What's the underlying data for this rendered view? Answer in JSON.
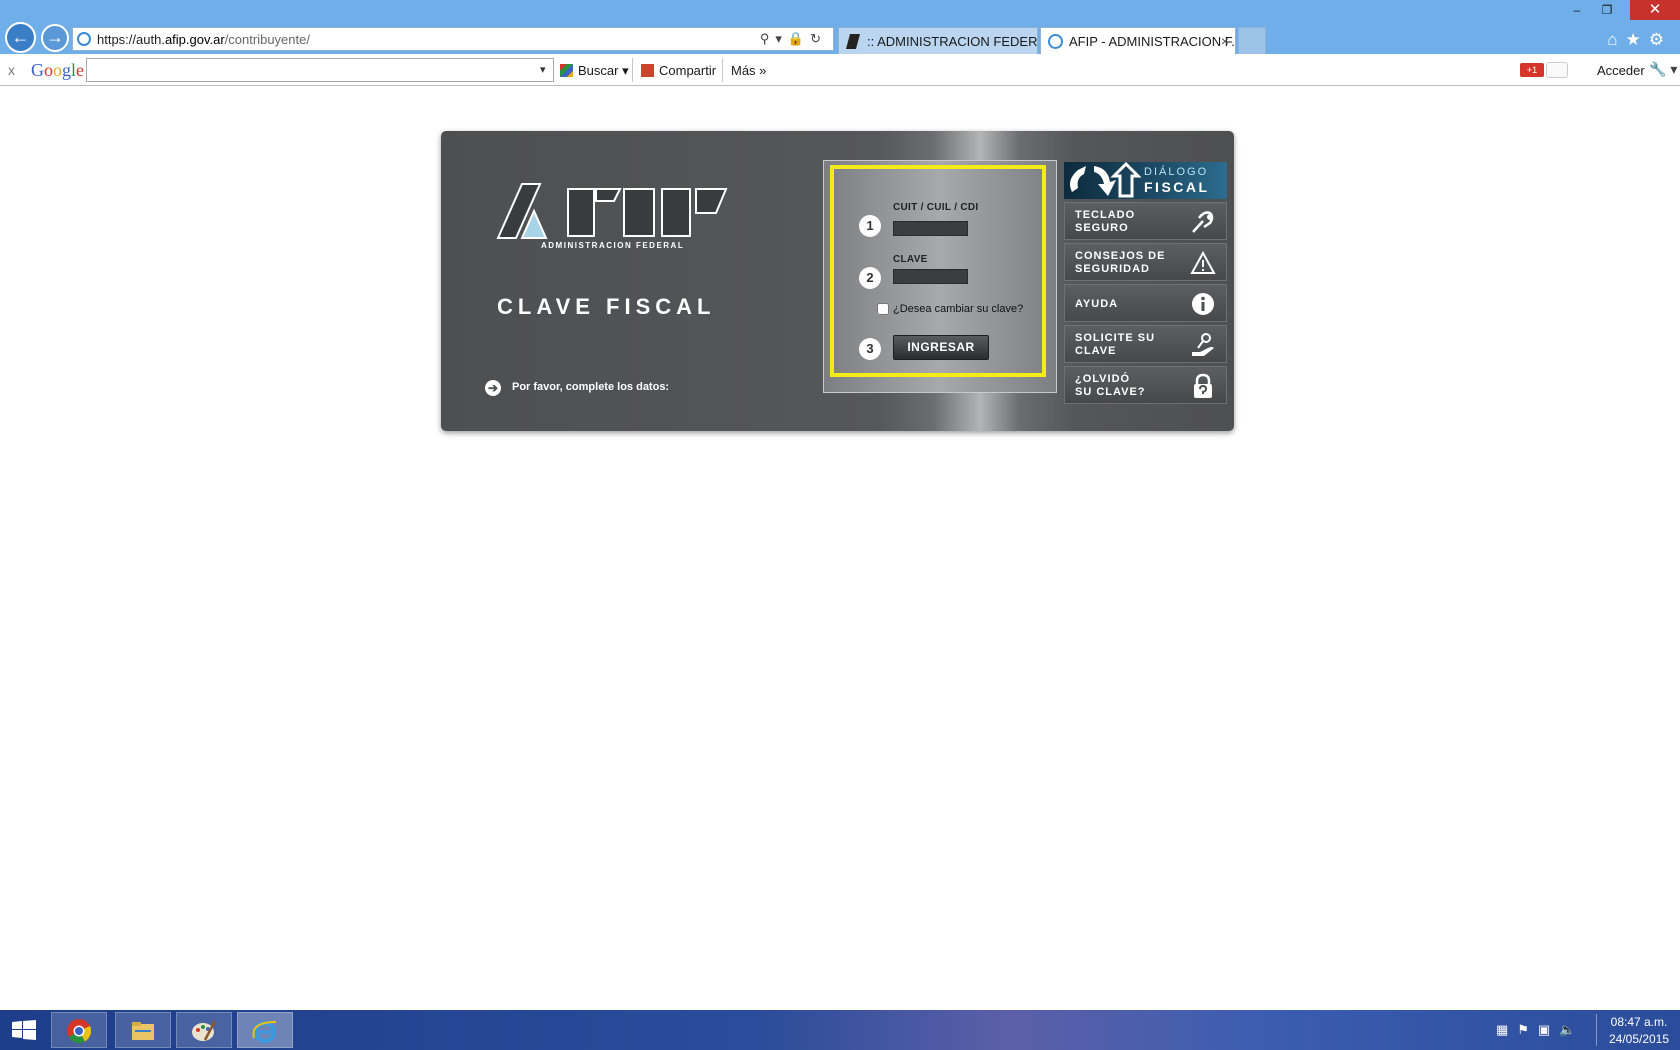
{
  "browser": {
    "url_prefix": "https://auth.",
    "url_domain": "afip.gov.ar",
    "url_path": "/contribuyente/",
    "tabs": [
      {
        "label": ":: ADMINISTRACION FEDERAL ..."
      },
      {
        "label": "AFIP - ADMINISTRACION F..."
      }
    ],
    "tab_close": "×",
    "window": {
      "minimize": "–",
      "maximize": "❐",
      "close": "✕"
    },
    "right_icons": "⌂★⚙",
    "address_icons": "⚲▾🔒↻"
  },
  "google_toolbar": {
    "close": "x",
    "logo": [
      "G",
      "o",
      "o",
      "g",
      "l",
      "e"
    ],
    "search_value": "",
    "search_arrow": "▾",
    "buscar": "Buscar ▾",
    "compartir": "Compartir",
    "mas": "Más »",
    "gplus": "+1",
    "acceder": "Acceder",
    "wrench": "🔧 ▾"
  },
  "afip": {
    "admin_federal": "ADMINISTRACION FEDERAL",
    "title": "CLAVE FISCAL",
    "instruction_icon": "➔",
    "instruction": "Por favor, complete los datos:",
    "form": {
      "steps": [
        "1",
        "2",
        "3"
      ],
      "cuit_label": "CUIT / CUIL / CDI",
      "cuit_value": "",
      "clave_label": "CLAVE",
      "clave_value": "",
      "change_label": "¿Desea cambiar su clave?",
      "change_checked": false,
      "submit_label": "INGRESAR"
    },
    "dialogo": {
      "top": "DIÁLOGO",
      "bottom": "FISCAL"
    },
    "menu": [
      {
        "line1": "TECLADO",
        "line2": "SEGURO"
      },
      {
        "line1": "CONSEJOS DE",
        "line2": "SEGURIDAD"
      },
      {
        "line1": "AYUDA",
        "line2": ""
      },
      {
        "line1": "SOLICITE SU",
        "line2": "CLAVE"
      },
      {
        "line1": "¿OLVIDÓ",
        "line2": "SU CLAVE?"
      }
    ]
  },
  "taskbar": {
    "tray_icons": "▦⚑▣🔈",
    "time": "08:47 a.m.",
    "date": "24/05/2015"
  },
  "colors": {
    "highlight_frame": "#f5eb18",
    "panel_dark": "#4e4f51",
    "browser_chrome": "#6faee9",
    "taskbar": "#2a4c9a"
  }
}
